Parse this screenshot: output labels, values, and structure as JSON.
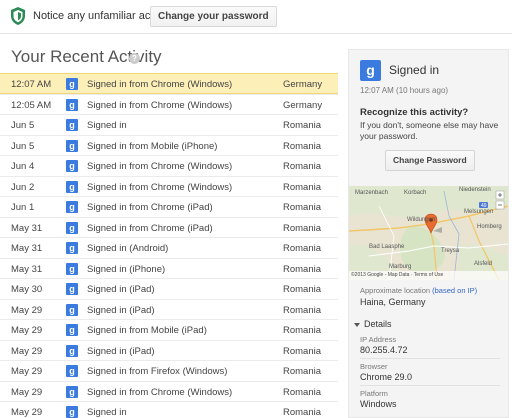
{
  "notice_bar": {
    "text": "Notice any unfamiliar activity?",
    "button_label": "Change your password"
  },
  "heading": {
    "title": "Your Recent Activity",
    "help_glyph": "?"
  },
  "activity": [
    {
      "date": "12:07 AM",
      "icon": "g",
      "event": "Signed in from Chrome (Windows)",
      "location": "Germany",
      "selected": true
    },
    {
      "date": "12:05 AM",
      "icon": "g",
      "event": "Signed in from Chrome (Windows)",
      "location": "Germany"
    },
    {
      "date": "Jun 5",
      "icon": "g",
      "event": "Signed in",
      "location": "Romania"
    },
    {
      "date": "Jun 5",
      "icon": "g",
      "event": "Signed in from Mobile (iPhone)",
      "location": "Romania"
    },
    {
      "date": "Jun 4",
      "icon": "g",
      "event": "Signed in from Chrome (Windows)",
      "location": "Romania"
    },
    {
      "date": "Jun 2",
      "icon": "g",
      "event": "Signed in from Chrome (Windows)",
      "location": "Romania"
    },
    {
      "date": "Jun 1",
      "icon": "g",
      "event": "Signed in from Chrome (iPad)",
      "location": "Romania"
    },
    {
      "date": "May 31",
      "icon": "g",
      "event": "Signed in from Chrome (iPad)",
      "location": "Romania"
    },
    {
      "date": "May 31",
      "icon": "g",
      "event": "Signed in (Android)",
      "location": "Romania"
    },
    {
      "date": "May 31",
      "icon": "g",
      "event": "Signed in (iPhone)",
      "location": "Romania"
    },
    {
      "date": "May 30",
      "icon": "g",
      "event": "Signed in (iPad)",
      "location": "Romania"
    },
    {
      "date": "May 29",
      "icon": "g",
      "event": "Signed in (iPad)",
      "location": "Romania"
    },
    {
      "date": "May 29",
      "icon": "g",
      "event": "Signed in from Mobile (iPad)",
      "location": "Romania"
    },
    {
      "date": "May 29",
      "icon": "g",
      "event": "Signed in (iPad)",
      "location": "Romania"
    },
    {
      "date": "May 29",
      "icon": "g",
      "event": "Signed in from Firefox (Windows)",
      "location": "Romania"
    },
    {
      "date": "May 29",
      "icon": "g",
      "event": "Signed in from Chrome (Windows)",
      "location": "Romania"
    },
    {
      "date": "May 29",
      "icon": "g",
      "event": "Signed in",
      "location": "Romania"
    }
  ],
  "panel": {
    "icon": "g",
    "title": "Signed in",
    "time": "12:07 AM (10 hours ago)",
    "recognize_heading": "Recognize this activity?",
    "recognize_text": "If you don't, someone else may have your password.",
    "change_password_label": "Change Password",
    "map": {
      "labels": [
        "Marzenbach",
        "Korbach",
        "Niedenstein",
        "Melsungen",
        "Homberg",
        "Wildungen",
        "Bad Laasphe",
        "Treysa",
        "Marburg",
        "Alsfeld"
      ],
      "road_number": "49",
      "footer": "©2013 Google - Map Data · Terms of Use"
    },
    "approx_label": "Approximate location",
    "approx_link": "(based on IP)",
    "approx_value": "Haina, Germany",
    "details_label": "Details",
    "ip_label": "IP Address",
    "ip_value": "80.255.4.72",
    "browser_label": "Browser",
    "browser_value": "Chrome 29.0",
    "platform_label": "Platform",
    "platform_value": "Windows"
  },
  "colors": {
    "google_blue": "#3b7be0",
    "selected_row": "#fcefb8",
    "shield_green": "#2e8b57",
    "link": "#3366cc"
  }
}
